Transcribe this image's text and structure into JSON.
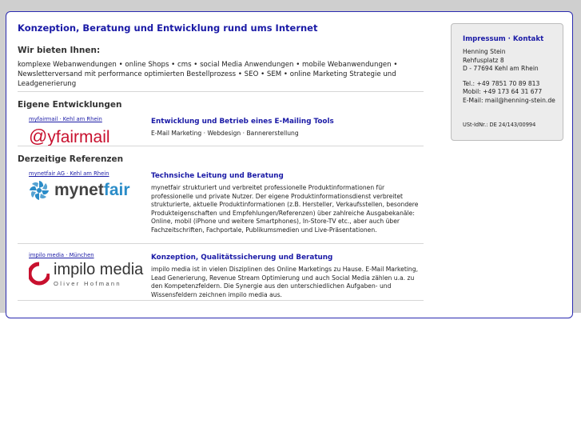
{
  "page": {
    "headline": "Konzeption, Beratung und Entwicklung rund ums Internet",
    "offer_heading": "Wir bieten Ihnen:",
    "offer_text": "komplexe Webanwendungen • online Shops • cms • social Media Anwendungen • mobile Webanwendungen • Newsletterversand mit performance optimierten Bestellprozess • SEO • SEM • online Marketing Strategie und Leadgenerierung",
    "own_heading": "Eigene Entwicklungen",
    "refs_heading": "Derzeitige Referenzen"
  },
  "entries": [
    {
      "source": "myfairmail · Kehl am Rhein",
      "logo_text": "yfairmail",
      "logo_at": "@",
      "title": "Entwicklung und Betrieb eines E-Mailing Tools",
      "desc": "E-Mail Marketing · Webdesign · Bannererstellung"
    },
    {
      "source": "mynetfair AG · Kehl am Rhein",
      "logo_part1": "mynet",
      "logo_part2": "fair",
      "title": "Technsiche Leitung und Beratung",
      "desc": "mynetfair strukturiert und verbreitet professionelle Produktinformationen für professionelle und private Nutzer. Der eigene Produktinformationsdienst verbreitet strukturierte, aktuelle Produktinformationen (z.B. Hersteller, Verkaufsstellen, besondere Produkteigenschaften und Empfehlungen/Referenzen) über zahlreiche Ausgabekanäle: Online, mobil (iPhone und weitere Smartphones), In-Store-TV etc., aber auch über Fachzeitschriften, Fachportale, Publikumsmedien und Live-Präsentationen."
    },
    {
      "source": "impilo media · München",
      "logo_main": "impilo media",
      "logo_sub": "Oliver Hofmann",
      "title": "Konzeption, Qualitätssicherung und Beratung",
      "desc": "impilo media ist in vielen Disziplinen des Online Marketings zu Hause. E-Mail Marketing, Lead Generierung, Revenue Stream Optimierung und auch Social Media zählen u.a. zu den Kompetenzfeldern. Die Synergie aus den unterschiedlichen Aufgaben- und Wissensfeldern zeichnen impilo media aus."
    }
  ],
  "sidebar": {
    "title": "Impressum · Kontakt",
    "name": "Henning Stein",
    "street": "Rehfusplatz 8",
    "city": "D - 77694 Kehl am Rhein",
    "tel": "Tel.: +49 7851 70 89 813",
    "mobil": "Mobil: +49 173 64 31 677",
    "email": "E-Mail: mail@henning-stein.de",
    "ust": "USt-IdNr.: DE 24/143/00994"
  },
  "colors": {
    "link_blue": "#1a1aa6",
    "card_border": "#2a2ab0",
    "background_band": "#cfcfcf",
    "fairmail_red": "#c8102e",
    "netfair_blue": "#2a8cc8"
  }
}
